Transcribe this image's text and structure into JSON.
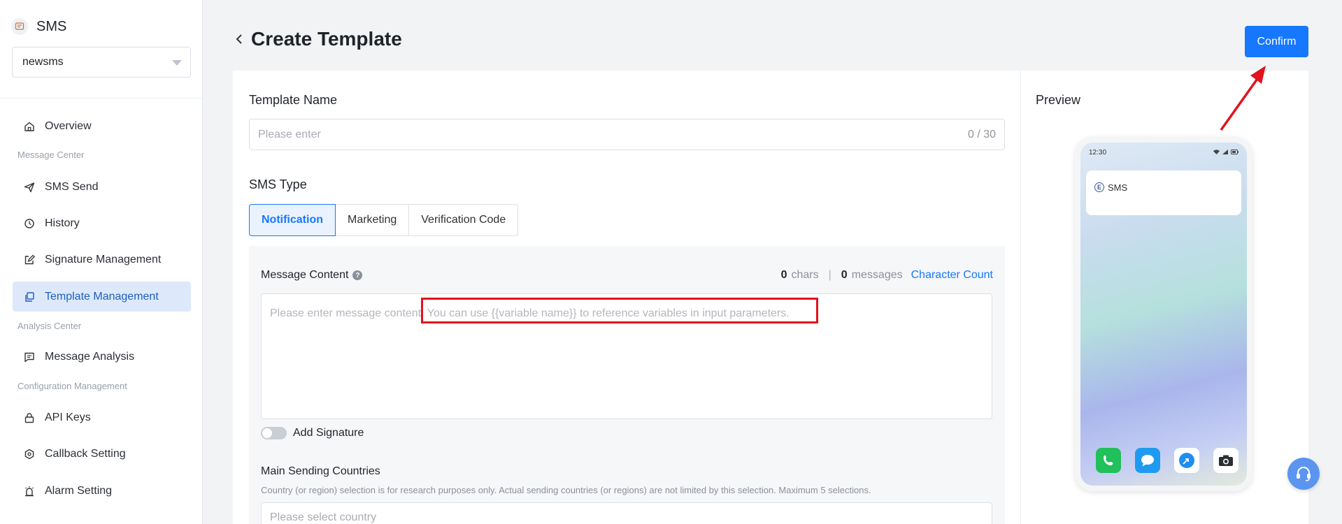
{
  "sidebar": {
    "brand": "SMS",
    "app_selector": "newsms",
    "groups": {
      "message_center": "Message Center",
      "analysis_center": "Analysis Center",
      "configuration": "Configuration Management"
    },
    "items": {
      "overview": "Overview",
      "sms_send": "SMS Send",
      "history": "History",
      "signature": "Signature Management",
      "template": "Template Management",
      "message_analysis": "Message Analysis",
      "api_keys": "API Keys",
      "callback": "Callback Setting",
      "alarm": "Alarm Setting"
    },
    "active_item": "Template Management"
  },
  "header": {
    "title": "Create Template",
    "confirm_label": "Confirm"
  },
  "form": {
    "template_name_label": "Template Name",
    "template_name_placeholder": "Please enter",
    "template_name_counter": "0 / 30",
    "sms_type_label": "SMS Type",
    "sms_types": [
      "Notification",
      "Marketing",
      "Verification Code"
    ],
    "sms_type_selected": "Notification",
    "message_content_label": "Message Content",
    "chars_count": "0",
    "chars_label": "chars",
    "counter_separator": "|",
    "messages_count": "0",
    "messages_label": "messages",
    "character_count_link": "Character Count",
    "message_placeholder": "Please enter message content. You can use {{variable name}} to reference variables in input parameters.",
    "add_signature_label": "Add Signature",
    "countries_label": "Main Sending Countries",
    "countries_hint": "Country (or region) selection is for research purposes only. Actual sending countries (or regions) are not limited by this selection. Maximum 5 selections.",
    "countries_placeholder": "Please select country"
  },
  "preview": {
    "title": "Preview",
    "status_time": "12:30",
    "sms_sender_icon": "E",
    "sms_sender": "SMS"
  },
  "colors": {
    "primary": "#1677ff",
    "active_nav_bg": "#dde9fb",
    "annotation": "#e0141e"
  }
}
